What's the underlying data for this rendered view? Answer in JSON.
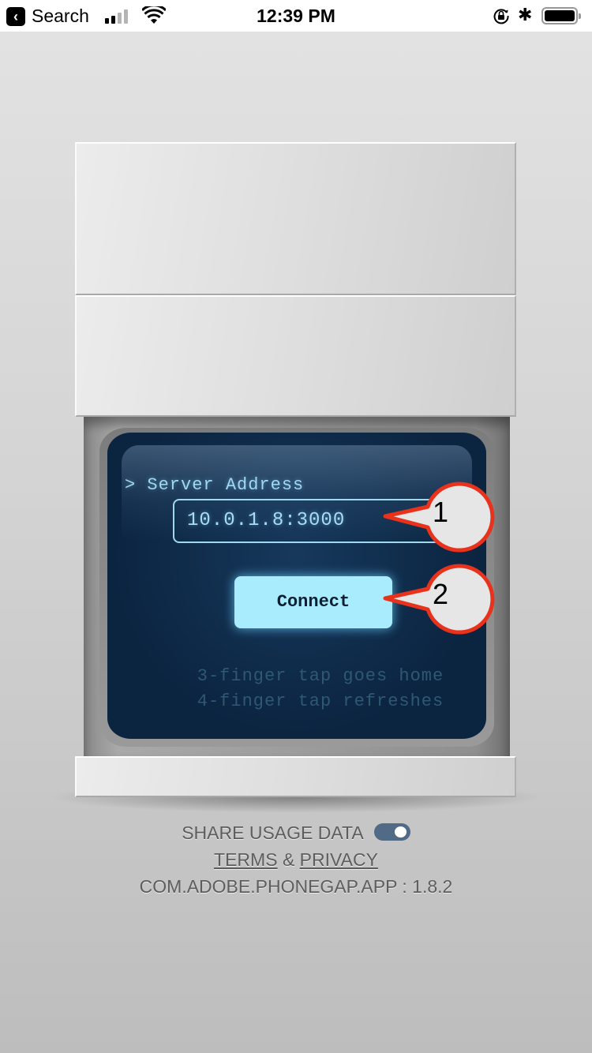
{
  "status_bar": {
    "back_app_label": "Search",
    "time": "12:39 PM",
    "signal_bars_filled": 2,
    "signal_bars_total": 4,
    "icons": [
      "back-arrow-icon",
      "cellular-signal-icon",
      "wifi-icon",
      "rotation-lock-icon",
      "bluetooth-icon",
      "battery-icon"
    ],
    "battery_level": 1.0
  },
  "terminal": {
    "prompt": ">",
    "label": "Server Address",
    "server_address": "10.0.1.8:3000",
    "connect_label": "Connect",
    "hints": [
      "3-finger tap goes home",
      "4-finger tap refreshes"
    ]
  },
  "callouts": [
    {
      "number": "1",
      "target": "server-address-input"
    },
    {
      "number": "2",
      "target": "connect-button"
    }
  ],
  "footer": {
    "share_usage_label": "SHARE USAGE DATA",
    "share_usage_enabled": true,
    "terms_label": "TERMS",
    "ampersand": "&",
    "privacy_label": "PRIVACY",
    "version_text": "COM.ADOBE.PHONEGAP.APP : 1.8.2"
  },
  "colors": {
    "screen_bg": "#0b2440",
    "terminal_text": "#9fd8ef",
    "button_bg": "#a8ecfd",
    "callout_border": "#e8321c",
    "toggle_on": "#516a86"
  }
}
